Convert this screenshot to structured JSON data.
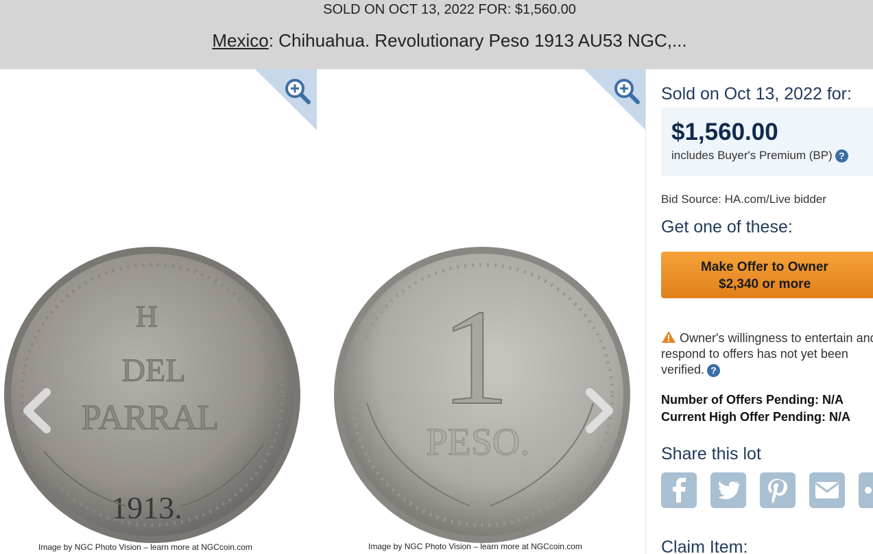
{
  "header": {
    "sold_line": "SOLD ON OCT 13, 2022 FOR: $1,560.00",
    "title_link": "Mexico",
    "title_rest": ": Chihuahua. Revolutionary Peso 1913 AU53 NGC,..."
  },
  "gallery": {
    "obverse_text": [
      "H",
      "DEL",
      "PARRAL",
      "1913."
    ],
    "reverse_text": [
      "1",
      "PESO."
    ],
    "caption": "Image by NGC Photo Vision – learn more at NGCcoin.com",
    "icons": [
      "zoom-in-icon",
      "chevron-left-icon",
      "chevron-right-icon"
    ]
  },
  "sidebar": {
    "sold_on": "Sold on Oct 13, 2022 for:",
    "price": "$1,560.00",
    "bp_note": "includes Buyer's Premium (BP)",
    "help_glyph": "?",
    "bid_source": "Bid Source: HA.com/Live bidder",
    "get_one": "Get one of these:",
    "offer_line1": "Make Offer to Owner",
    "offer_line2": "$2,340 or more",
    "warning": "Owner's willingness to entertain and respond to offers has not yet been verified.",
    "offers_pending": "Number of Offers Pending: N/A",
    "high_offer": "Current High Offer Pending: N/A",
    "share": "Share this lot",
    "share_icons": [
      "facebook-icon",
      "twitter-icon",
      "pinterest-icon",
      "email-icon",
      "more-icon"
    ],
    "claim": "Claim Item:"
  },
  "colors": {
    "header_bg": "#d5d5d5",
    "heading_blue": "#1f3a5c",
    "offer_orange": "#f0921f",
    "share_icon": "#a9bfd2",
    "price_box": "#eef5fb"
  }
}
